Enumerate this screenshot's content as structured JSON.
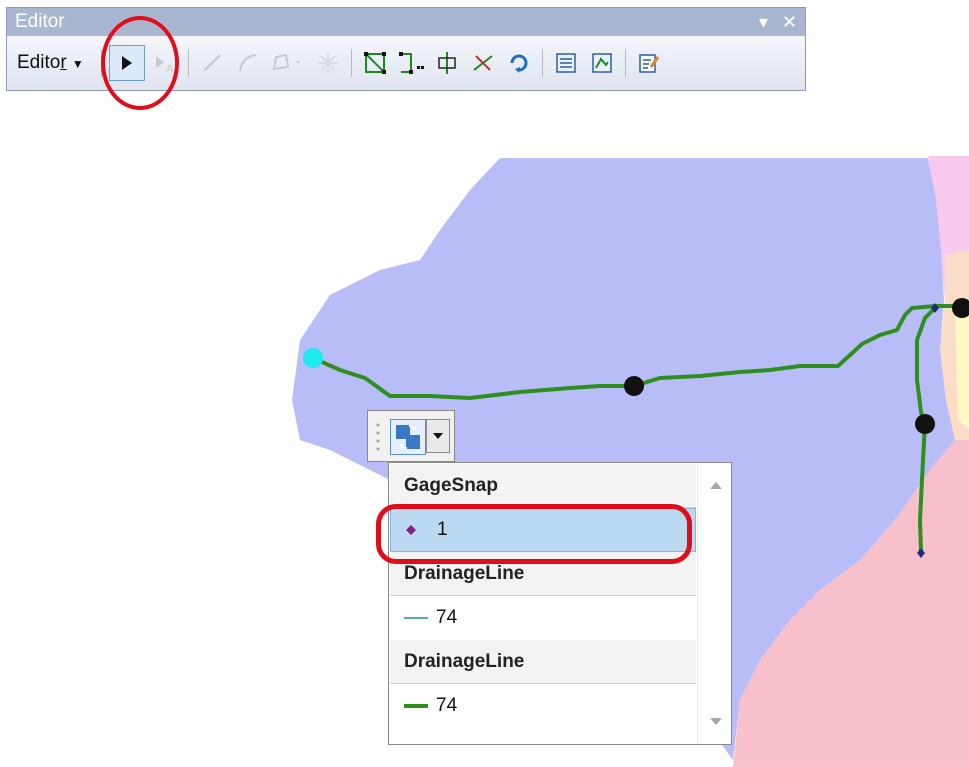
{
  "editor": {
    "title": "Editor",
    "menu_label_main": "Edito",
    "menu_label_underlined": "r",
    "title_controls": {
      "menu": "▾",
      "close": "✕"
    },
    "tools": [
      "edit-tool-icon",
      "annotation-tool-icon",
      "straight-segment-icon",
      "end-point-arc-icon",
      "construction-tools-icon",
      "reshape-feature-icon",
      "edit-vertices-icon",
      "modify-vertices-icon",
      "split-tool-icon",
      "cut-polygons-icon",
      "rotate-tool-icon",
      "attributes-icon",
      "sketch-properties-icon",
      "create-features-icon"
    ]
  },
  "popup": {
    "groups": [
      {
        "title": "GageSnap",
        "value": "1",
        "symbol": "diamond-point-icon",
        "selected": true
      },
      {
        "title": "DrainageLine",
        "value": "74",
        "symbol": "thin-line-icon",
        "selected": false
      },
      {
        "title": "DrainageLine",
        "value": "74",
        "symbol": "thick-line-icon",
        "selected": false
      }
    ]
  },
  "colors": {
    "watershed": "#b8bdf7",
    "neighbor_pink": "#f8c0cb",
    "neighbor_orange": "#fddcc0",
    "stream": "#2f8f1e",
    "gage": "#1ee8f0",
    "highlight": "#e00e1a"
  }
}
